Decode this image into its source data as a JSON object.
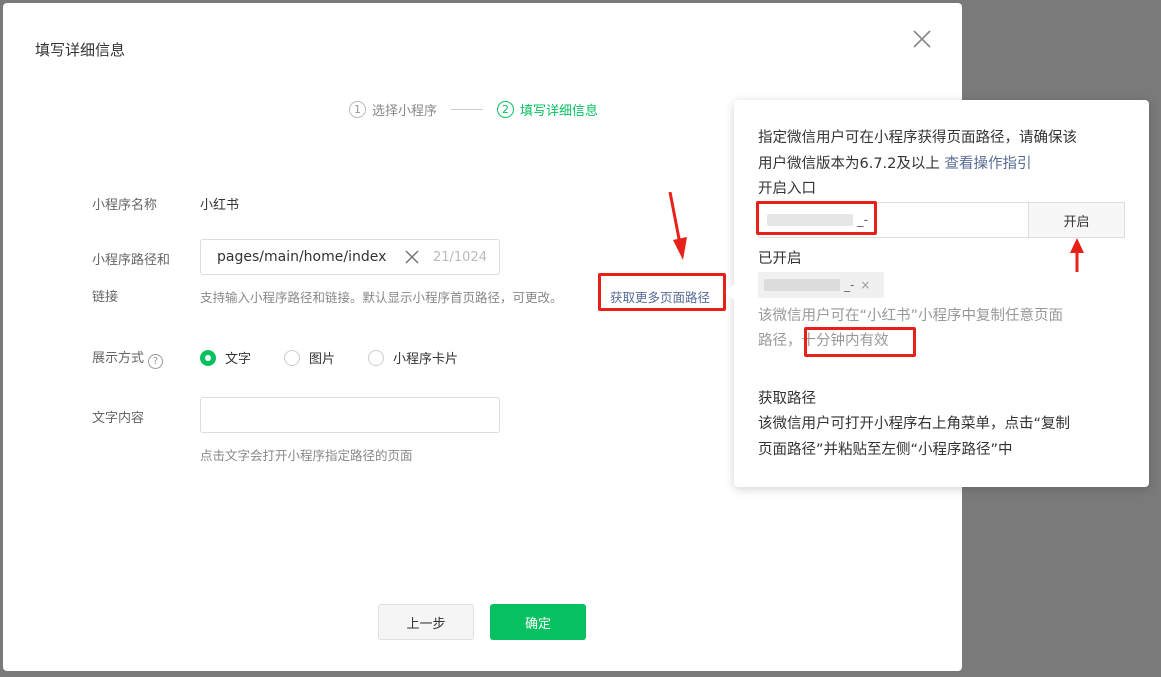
{
  "dialog": {
    "title": "填写详细信息",
    "steps": [
      {
        "num": "1",
        "label": "选择小程序"
      },
      {
        "num": "2",
        "label": "填写详细信息"
      }
    ],
    "form": {
      "name_label": "小程序名称",
      "name_value": "小红书",
      "path_label_line1": "小程序路径和",
      "path_label_line2": "链接",
      "path_value": "pages/main/home/index",
      "path_counter": "21/1024",
      "path_hint": "支持输入小程序路径和链接。默认显示小程序首页路径，可更改。",
      "path_more_link": "获取更多页面路径",
      "display_label": "展示方式",
      "display_options": [
        "文字",
        "图片",
        "小程序卡片"
      ],
      "display_selected": "文字",
      "text_label": "文字内容",
      "text_value": "",
      "text_hint": "点击文字会打开小程序指定路径的页面"
    },
    "buttons": {
      "prev": "上一步",
      "ok": "确定"
    }
  },
  "popover": {
    "intro_line1": "指定微信用户可在小程序获得页面路径，请确保该",
    "intro_line2": "用户微信版本为6.7.2及以上",
    "guide_link": "查看操作指引",
    "entry_title": "开启入口",
    "entry_input_suffix": "_-",
    "open_button": "开启",
    "enabled_title": "已开启",
    "enabled_tag_suffix": "_-",
    "enabled_desc_line1": "该微信用户可在“小红书”小程序中复制任意页面",
    "enabled_desc_line2_prefix": "路径，",
    "enabled_desc_highlight": "十分钟内有效",
    "get_path_title": "获取路径",
    "get_path_line1": "该微信用户可打开小程序右上角菜单，点击“复制",
    "get_path_line2": "页面路径”并粘贴至左侧“小程序路径”中"
  },
  "colors": {
    "accent": "#07c160",
    "link": "#576b95",
    "annotation": "#e8201a"
  }
}
